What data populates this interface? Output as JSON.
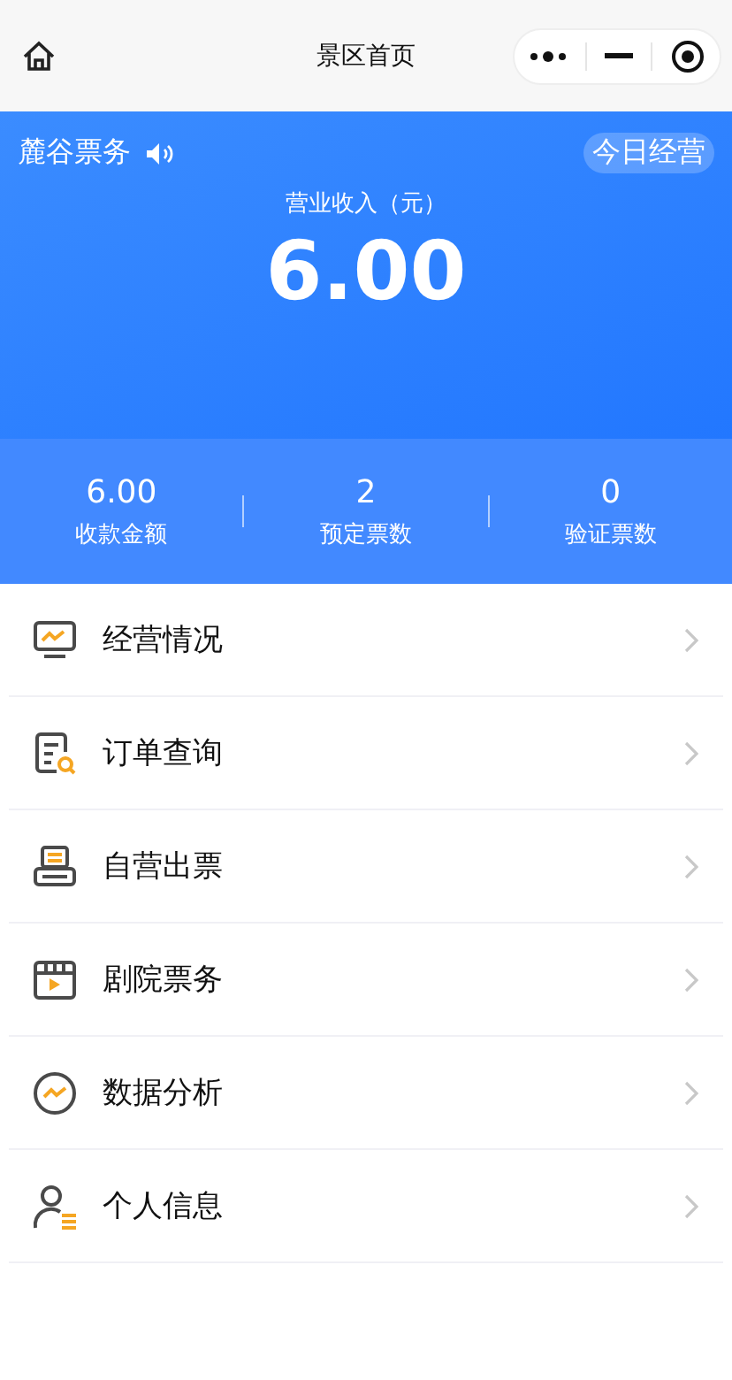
{
  "nav_bar": {
    "title": "景区首页"
  },
  "header": {
    "brand": "麓谷票务",
    "badge": "今日经营",
    "revenue_label": "营业收入（元）",
    "revenue": "6.00"
  },
  "stats": [
    {
      "value": "6.00",
      "label": "收款金额"
    },
    {
      "value": "2",
      "label": "预定票数"
    },
    {
      "value": "0",
      "label": "验证票数"
    }
  ],
  "menu": [
    {
      "kind": "monitor",
      "label": "经营情况"
    },
    {
      "kind": "order",
      "label": "订单查询"
    },
    {
      "kind": "printer",
      "label": "自营出票"
    },
    {
      "kind": "theater",
      "label": "剧院票务"
    },
    {
      "kind": "analysis",
      "label": "数据分析"
    },
    {
      "kind": "profile",
      "label": "个人信息"
    }
  ]
}
